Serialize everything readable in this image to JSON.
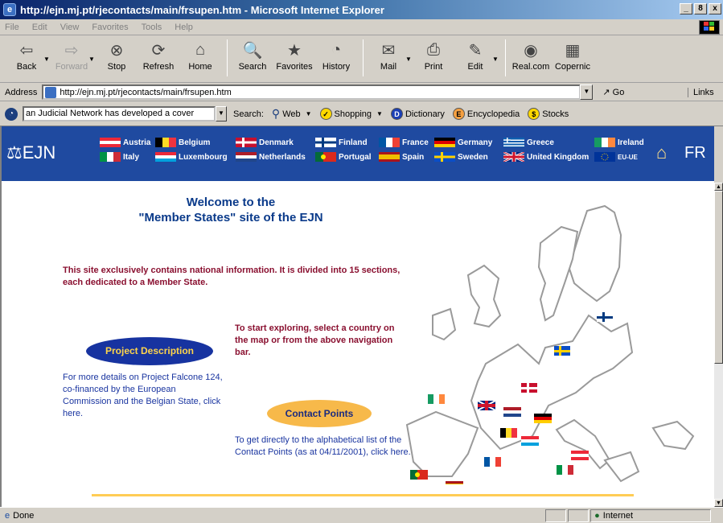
{
  "window": {
    "title": "http://ejn.mj.pt/rjecontacts/main/frsupen.htm - Microsoft Internet Explorer",
    "buttons": [
      "_",
      "8",
      "x"
    ]
  },
  "menu": [
    "File",
    "Edit",
    "View",
    "Favorites",
    "Tools",
    "Help"
  ],
  "toolbar": [
    {
      "label": "Back",
      "icon": "back-arrow-icon",
      "glyph": "⇦",
      "enabled": true
    },
    {
      "label": "Forward",
      "icon": "forward-arrow-icon",
      "glyph": "⇨",
      "enabled": false
    },
    {
      "label": "Stop",
      "icon": "stop-icon",
      "glyph": "⊗",
      "enabled": true
    },
    {
      "label": "Refresh",
      "icon": "refresh-icon",
      "glyph": "⟳",
      "enabled": true
    },
    {
      "label": "Home",
      "icon": "home-icon",
      "glyph": "⌂",
      "enabled": true
    },
    {
      "label": "Search",
      "icon": "search-icon",
      "glyph": "🔍",
      "enabled": true
    },
    {
      "label": "Favorites",
      "icon": "favorites-icon",
      "glyph": "★",
      "enabled": true
    },
    {
      "label": "History",
      "icon": "history-icon",
      "glyph": "◔",
      "enabled": true
    },
    {
      "label": "Mail",
      "icon": "mail-icon",
      "glyph": "✉",
      "enabled": true
    },
    {
      "label": "Print",
      "icon": "print-icon",
      "glyph": "⎙",
      "enabled": true
    },
    {
      "label": "Edit",
      "icon": "edit-icon",
      "glyph": "✎",
      "enabled": true
    },
    {
      "label": "Real.com",
      "icon": "realcom-icon",
      "glyph": "◉",
      "enabled": true
    },
    {
      "label": "Copernic",
      "icon": "copernic-icon",
      "glyph": "▦",
      "enabled": true
    }
  ],
  "address": {
    "label": "Address",
    "url": "http://ejn.mj.pt/rjecontacts/main/frsupen.htm",
    "go": "Go",
    "links": "Links"
  },
  "searchbar": {
    "input": "an Judicial Network has developed a cover",
    "label": "Search:",
    "items": [
      "Web",
      "Shopping",
      "Dictionary",
      "Encyclopedia",
      "Stocks"
    ]
  },
  "nav": {
    "logo": "EJN",
    "countries": [
      "Austria",
      "Belgium",
      "Denmark",
      "Finland",
      "France",
      "Germany",
      "Greece",
      "Ireland",
      "Italy",
      "Luxembourg",
      "Netherlands",
      "Portugal",
      "Spain",
      "Sweden",
      "United Kingdom",
      "EU-UE"
    ],
    "lang": "FR"
  },
  "content": {
    "welcome1": "Welcome to the",
    "welcome2": "\"Member States\" site of the EJN",
    "intro": "This site exclusively contains national information. It is divided into 15 sections, each dedicated to a Member State.",
    "explore": "To start exploring, select a country on the map or from the above navigation bar.",
    "project_button": "Project Description",
    "project_text": "For more details on Project Falcone 124, co-financed by the European Commission and the Belgian State, click here.",
    "contact_button": "Contact Points",
    "contact_text": "To get directly to the alphabetical list of the Contact Points (as at 04/11/2001), click here."
  },
  "status": {
    "left": "Done",
    "zone": "Internet"
  }
}
